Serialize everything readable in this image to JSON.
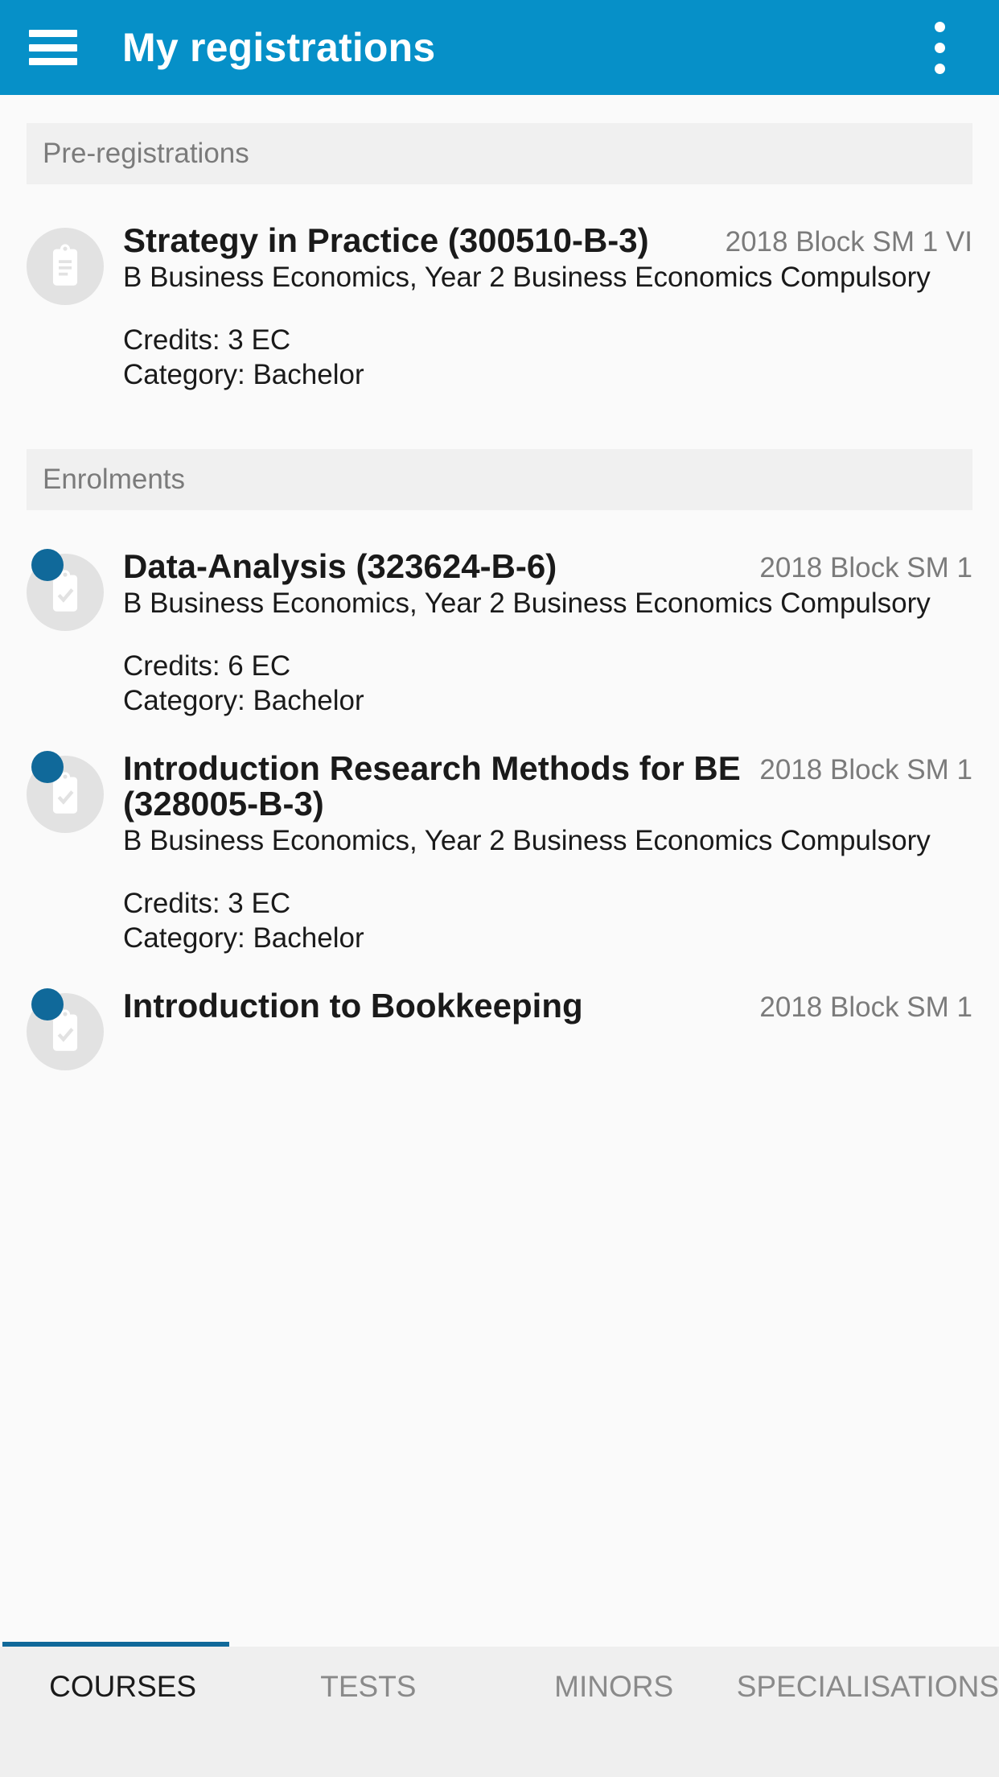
{
  "appbar": {
    "title": "My registrations",
    "menu_icon": "hamburger-menu-icon",
    "overflow_icon": "more-vert-icon",
    "background_color": "#0690C8"
  },
  "accent_color": "#10699A",
  "sections": [
    {
      "label": "Pre-registrations",
      "items": [
        {
          "title": "Strategy in Practice (300510-B-3)",
          "block": "2018 Block SM 1 VI",
          "program": "B Business Economics, Year 2 Business Economics Compulsory",
          "credits": "Credits: 3 EC",
          "category": "Category: Bachelor",
          "icon": "clipboard-icon",
          "has_badge": false
        }
      ]
    },
    {
      "label": "Enrolments",
      "items": [
        {
          "title": "Data-Analysis (323624-B-6)",
          "block": "2018 Block SM 1",
          "program": "B Business Economics, Year 2 Business Economics Compulsory",
          "credits": "Credits: 6 EC",
          "category": "Category: Bachelor",
          "icon": "clipboard-check-icon",
          "has_badge": true
        },
        {
          "title": "Introduction Research Methods for BE (328005-B-3)",
          "block": "2018 Block SM 1",
          "program": "B Business Economics, Year 2 Business Economics Compulsory",
          "credits": "Credits: 3 EC",
          "category": "Category: Bachelor",
          "icon": "clipboard-check-icon",
          "has_badge": true
        },
        {
          "title": "Introduction to Bookkeeping",
          "block": "2018 Block SM 1",
          "program": "",
          "credits": "",
          "category": "",
          "icon": "clipboard-check-icon",
          "has_badge": true
        }
      ]
    }
  ],
  "tabs": [
    {
      "label": "COURSES",
      "active": true
    },
    {
      "label": "TESTS",
      "active": false
    },
    {
      "label": "MINORS",
      "active": false
    },
    {
      "label": "SPECIALISATIONS",
      "active": false
    }
  ]
}
